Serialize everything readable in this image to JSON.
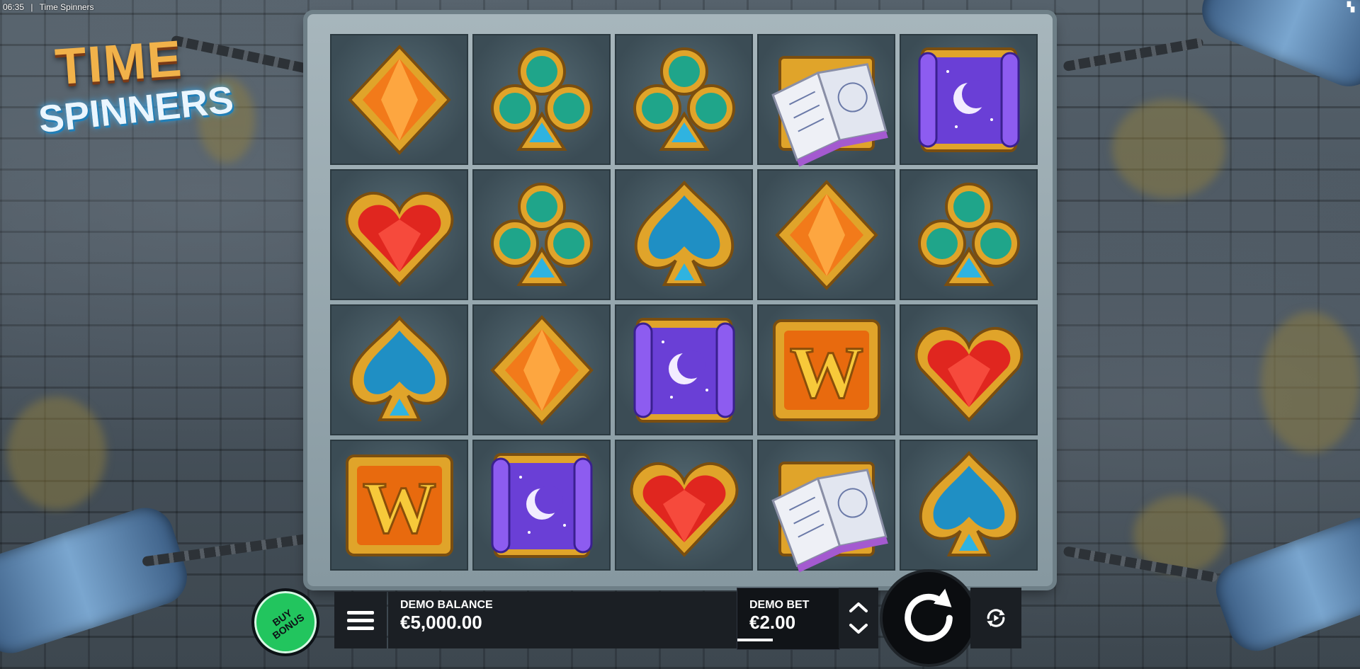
{
  "window": {
    "time": "06:35",
    "separator": "|",
    "title": "Time Spinners"
  },
  "logo": {
    "line1": "TIME",
    "line2": "SPINNERS"
  },
  "grid": {
    "rows": [
      [
        "orange-diamond",
        "green-club",
        "green-club",
        "spell-book",
        "moon-scroll"
      ],
      [
        "red-heart",
        "green-club",
        "blue-spade",
        "orange-diamond",
        "green-club"
      ],
      [
        "blue-spade",
        "orange-diamond",
        "moon-scroll",
        "wild-w",
        "red-heart"
      ],
      [
        "wild-w",
        "moon-scroll",
        "red-heart",
        "spell-book",
        "blue-spade"
      ]
    ]
  },
  "buy_bonus": {
    "line1": "BUY",
    "line2": "BONUS"
  },
  "balance": {
    "label": "DEMO BALANCE",
    "value": "€5,000.00"
  },
  "bet": {
    "label": "DEMO BET",
    "value": "€2.00"
  },
  "colors": {
    "buy_bonus": "#22c55e",
    "panel": "#1b1f24",
    "gold": "#e0a42a"
  }
}
